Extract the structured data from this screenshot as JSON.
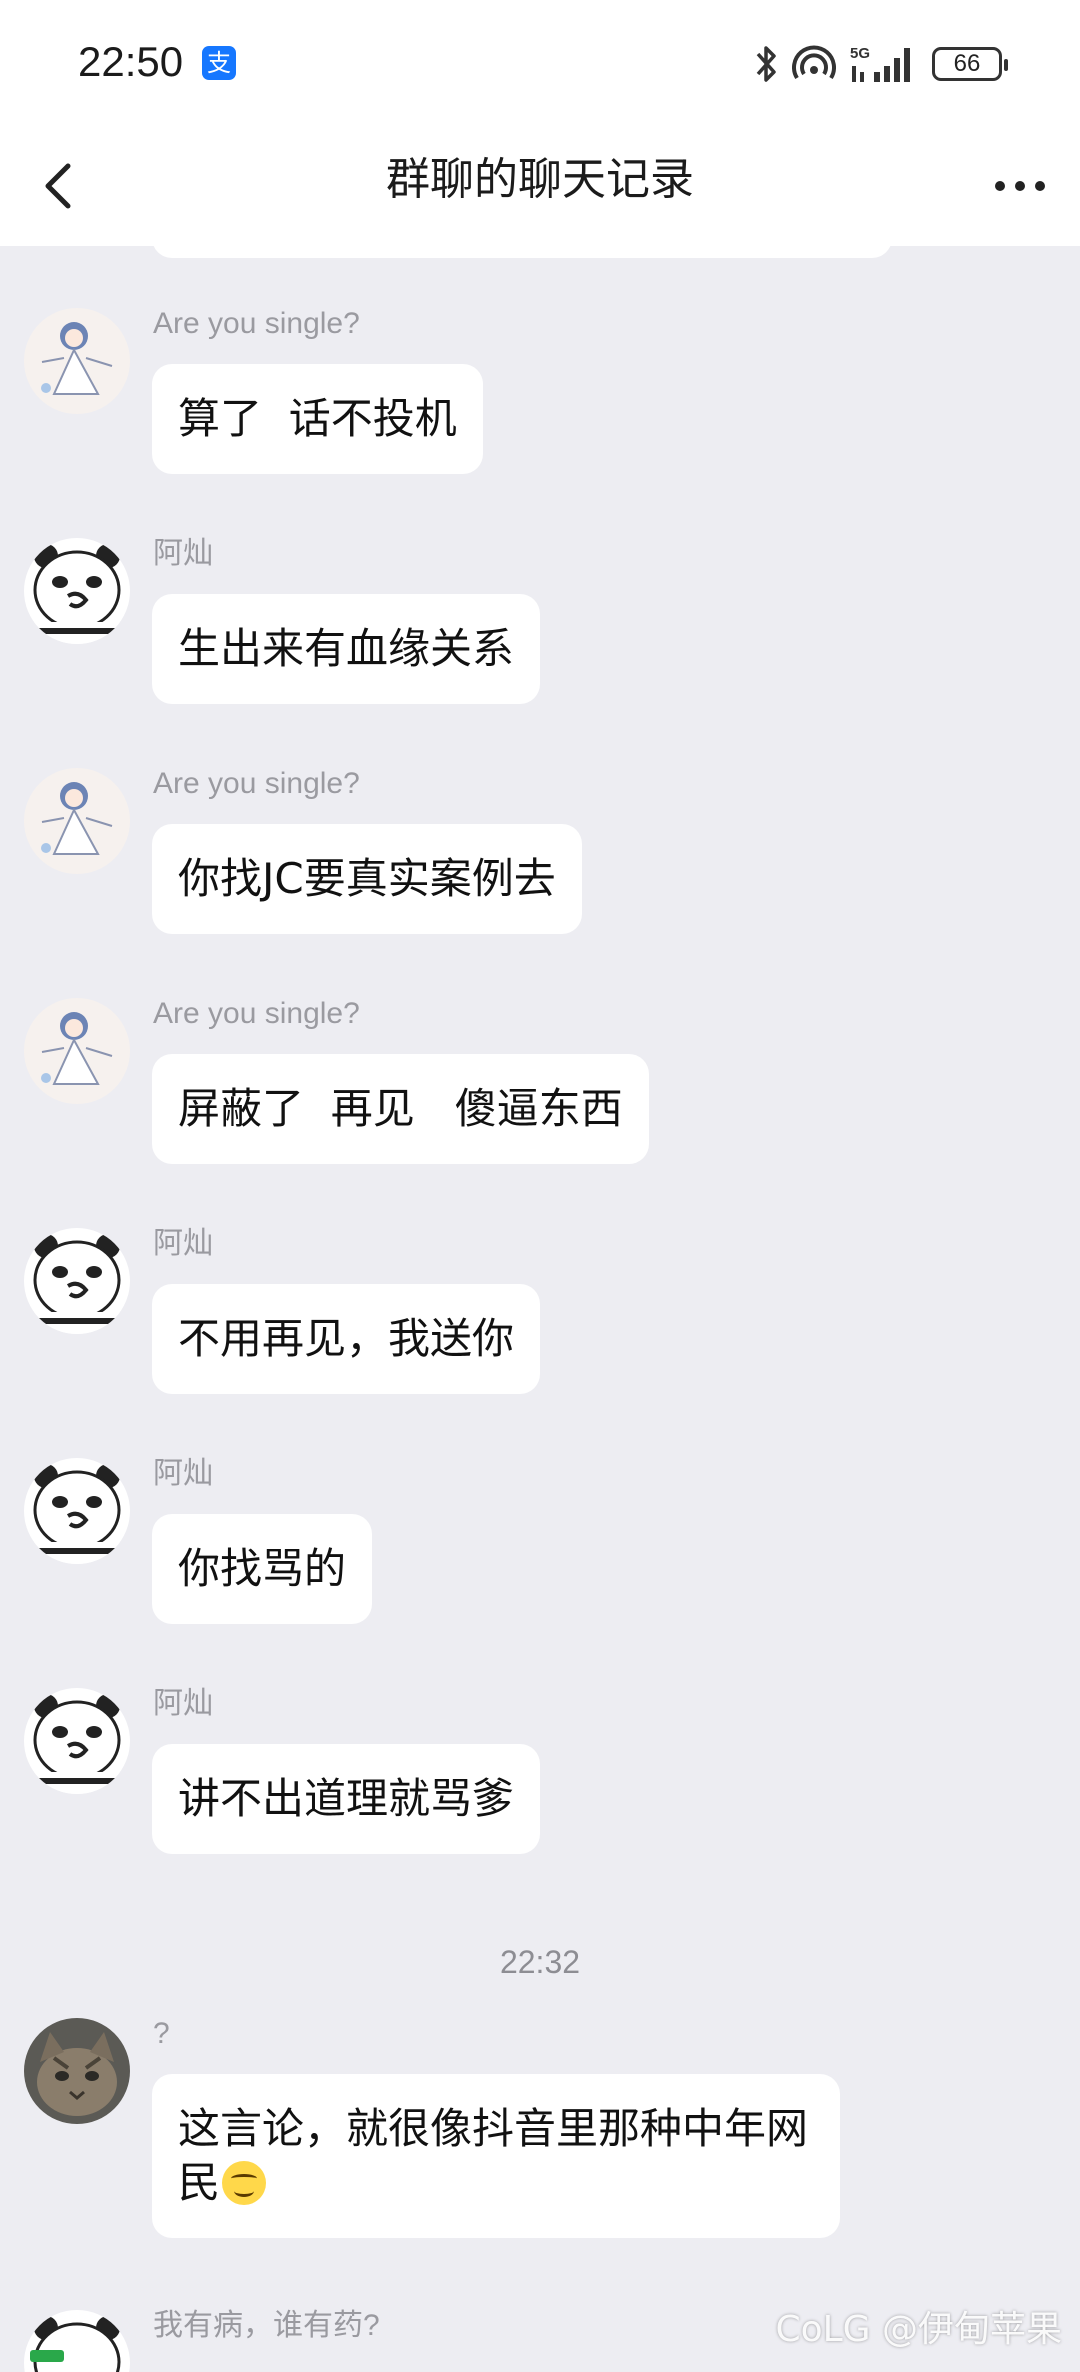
{
  "status_bar": {
    "time": "22:50",
    "alipay_badge": "支",
    "network": "5G",
    "battery": "66"
  },
  "nav": {
    "title": "群聊的聊天记录"
  },
  "messages": [
    {
      "sender": "Are you single?",
      "avatar": "anime-girl-avatar",
      "text": "算了  话不投机"
    },
    {
      "sender": "阿灿",
      "avatar": "panda-meme-avatar",
      "text": "生出来有血缘关系"
    },
    {
      "sender": "Are you single?",
      "avatar": "anime-girl-avatar",
      "text": "你找JC要真实案例去"
    },
    {
      "sender": "Are you single?",
      "avatar": "anime-girl-avatar",
      "text": "屏蔽了  再见   傻逼东西"
    },
    {
      "sender": "阿灿",
      "avatar": "panda-meme-avatar",
      "text": "不用再见，我送你"
    },
    {
      "sender": "阿灿",
      "avatar": "panda-meme-avatar",
      "text": "你找骂的"
    },
    {
      "sender": "阿灿",
      "avatar": "panda-meme-avatar",
      "text": "讲不出道理就骂爹"
    },
    {
      "sender": "?",
      "avatar": "cat-avatar",
      "text": "这言论，就很像抖音里那种中年网民"
    },
    {
      "sender": "我有病，谁有药?",
      "avatar": "panda-meme-avatar"
    }
  ],
  "timestamp": "22:32",
  "watermark": "CoLG @伊甸苹果",
  "colors": {
    "background": "#ededf2",
    "bubble": "#ffffff",
    "sender_name": "#9a9aa0"
  }
}
